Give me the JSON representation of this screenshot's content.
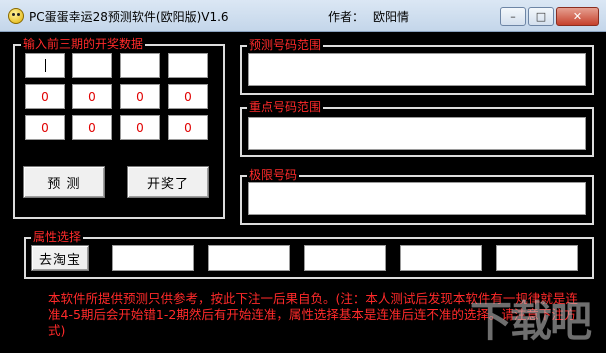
{
  "window": {
    "title": "PC蛋蛋幸运28预测软件(欧阳版)V1.6",
    "author_label": "作者：",
    "author_name": "欧阳情",
    "controls": {
      "minimize": "–",
      "maximize": "□",
      "close": "✕"
    }
  },
  "input_group": {
    "title": "输入前三期的开奖数据",
    "rows": [
      [
        "",
        "",
        "",
        ""
      ],
      [
        "0",
        "0",
        "0",
        "0"
      ],
      [
        "0",
        "0",
        "0",
        "0"
      ]
    ],
    "predict_button": "预 测",
    "draw_button": "开奖了"
  },
  "predict_range": {
    "title": "预测号码范围",
    "value": ""
  },
  "key_range": {
    "title": "重点号码范围",
    "value": ""
  },
  "limit_numbers": {
    "title": "极限号码",
    "value": ""
  },
  "attribute_group": {
    "title": "属性选择",
    "taobao_button": "去淘宝",
    "boxes": [
      "",
      "",
      "",
      "",
      ""
    ]
  },
  "notice": "本软件所提供预测只供参考，按此下注一后果自负。(注：本人测试后发现本软件有一规律就是连准4-5期后会开始错1-2期然后有开始连准，属性选择基本是连准后连不准的选择。请注意下注方式)",
  "watermark": "下载吧"
}
